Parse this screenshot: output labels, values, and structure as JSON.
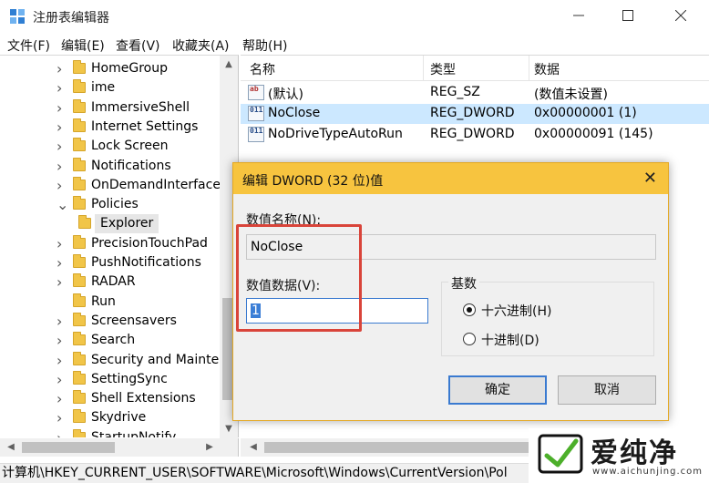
{
  "window": {
    "title": "注册表编辑器"
  },
  "menu": [
    "文件(F)",
    "编辑(E)",
    "查看(V)",
    "收藏夹(A)",
    "帮助(H)"
  ],
  "tree": {
    "items": [
      {
        "label": "HomeGroup",
        "expand": ">"
      },
      {
        "label": "ime",
        "expand": ">"
      },
      {
        "label": "ImmersiveShell",
        "expand": ">"
      },
      {
        "label": "Internet Settings",
        "expand": ">"
      },
      {
        "label": "Lock Screen",
        "expand": ">"
      },
      {
        "label": "Notifications",
        "expand": ">"
      },
      {
        "label": "OnDemandInterface",
        "expand": ">"
      },
      {
        "label": "Policies",
        "expand": "v"
      },
      {
        "label": "Explorer",
        "expand": ""
      },
      {
        "label": "PrecisionTouchPad",
        "expand": ">"
      },
      {
        "label": "PushNotifications",
        "expand": ">"
      },
      {
        "label": "RADAR",
        "expand": ">"
      },
      {
        "label": "Run",
        "expand": ""
      },
      {
        "label": "Screensavers",
        "expand": ">"
      },
      {
        "label": "Search",
        "expand": ">"
      },
      {
        "label": "Security and Mainte",
        "expand": ">"
      },
      {
        "label": "SettingSync",
        "expand": ">"
      },
      {
        "label": "Shell Extensions",
        "expand": ">"
      },
      {
        "label": "Skydrive",
        "expand": ">"
      },
      {
        "label": "StartupNotify",
        "expand": ">"
      }
    ]
  },
  "list": {
    "headers": {
      "name": "名称",
      "type": "类型",
      "data": "数据"
    },
    "rows": [
      {
        "icon": "ab",
        "name": "(默认)",
        "type": "REG_SZ",
        "data": "(数值未设置)"
      },
      {
        "icon": "011",
        "name": "NoClose",
        "type": "REG_DWORD",
        "data": "0x00000001 (1)"
      },
      {
        "icon": "011",
        "name": "NoDriveTypeAutoRun",
        "type": "REG_DWORD",
        "data": "0x00000091 (145)"
      }
    ]
  },
  "statusbar": {
    "path": "计算机\\HKEY_CURRENT_USER\\SOFTWARE\\Microsoft\\Windows\\CurrentVersion\\Pol"
  },
  "dialog": {
    "title": "编辑 DWORD (32 位)值",
    "close": "✕",
    "value_name_label": "数值名称(N):",
    "value_name": "NoClose",
    "value_data_label": "数值数据(V):",
    "value_data": "1",
    "base_label": "基数",
    "radix_hex": "十六进制(H)",
    "radix_dec": "十进制(D)",
    "radix_selected": "hex",
    "ok": "确定",
    "cancel": "取消"
  },
  "watermark": {
    "text": "爱纯净",
    "url": "www.aichunjing.com"
  },
  "colors": {
    "dialog_title": "#f7c43f",
    "selection": "#cce8ff",
    "highlight_box": "#d9443a",
    "focus": "#3a7ad0"
  }
}
